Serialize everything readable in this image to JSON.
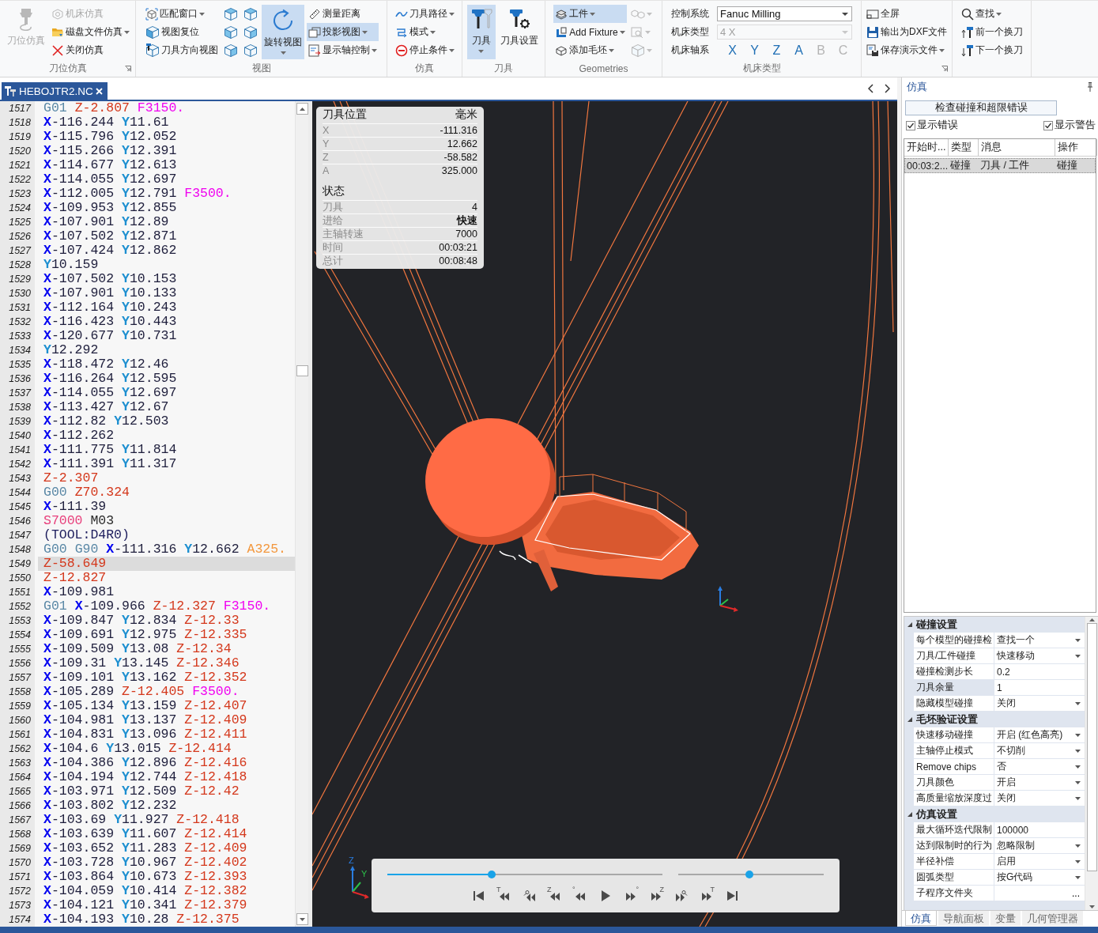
{
  "ribbon": {
    "groups": [
      {
        "label": "刀位仿真",
        "launcher": true,
        "items": [
          {
            "kind": "large",
            "label": "刀位仿真",
            "dropdown": false,
            "selected": false,
            "disabled": true
          },
          {
            "kind": "small",
            "label": "机床仿真",
            "dropdown": false,
            "selected": false,
            "disabled": true
          },
          {
            "kind": "small",
            "label": "磁盘文件仿真",
            "dropdown": true,
            "selected": false,
            "disabled": false
          },
          {
            "kind": "small",
            "label": "关闭仿真",
            "dropdown": false,
            "selected": false,
            "disabled": false
          }
        ]
      },
      {
        "label": "视图",
        "items": [
          {
            "kind": "small",
            "label": "匹配窗口",
            "dropdown": true,
            "selected": false,
            "disabled": false
          },
          {
            "kind": "small",
            "label": "视图复位",
            "dropdown": false,
            "selected": false,
            "disabled": false
          },
          {
            "kind": "small",
            "label": "刀具方向视图",
            "dropdown": false,
            "selected": false,
            "disabled": false
          },
          {
            "kind": "icon",
            "dropdown": false,
            "selected": false,
            "disabled": false
          },
          {
            "kind": "icon",
            "dropdown": false,
            "selected": false,
            "disabled": false
          },
          {
            "kind": "icon",
            "dropdown": false,
            "selected": false,
            "disabled": false
          },
          {
            "kind": "icon",
            "dropdown": false,
            "selected": false,
            "disabled": false
          },
          {
            "kind": "icon",
            "dropdown": false,
            "selected": false,
            "disabled": false
          },
          {
            "kind": "icon",
            "dropdown": false,
            "selected": false,
            "disabled": false
          },
          {
            "kind": "large",
            "label": "旋转视图",
            "dropdown": true,
            "selected": true,
            "disabled": false
          },
          {
            "kind": "small",
            "label": "测量距离",
            "dropdown": false,
            "selected": false,
            "disabled": false
          },
          {
            "kind": "small",
            "label": "投影视图",
            "dropdown": true,
            "selected": true,
            "disabled": false
          },
          {
            "kind": "small",
            "label": "显示轴控制",
            "dropdown": true,
            "selected": false,
            "disabled": false
          }
        ]
      },
      {
        "label": "仿真",
        "items": [
          {
            "kind": "small",
            "label": "刀具路径",
            "dropdown": true,
            "selected": false,
            "disabled": false
          },
          {
            "kind": "small",
            "label": "模式",
            "dropdown": true,
            "selected": false,
            "disabled": false
          },
          {
            "kind": "small",
            "label": "停止条件",
            "dropdown": true,
            "selected": false,
            "disabled": false
          }
        ]
      },
      {
        "label": "刀具",
        "items": [
          {
            "kind": "large",
            "label": "刀具",
            "dropdown": true,
            "selected": true,
            "disabled": false
          },
          {
            "kind": "large",
            "label": "刀具设置",
            "dropdown": false,
            "selected": false,
            "disabled": false
          }
        ]
      },
      {
        "label": "Geometries",
        "items": [
          {
            "kind": "small",
            "label": "工件",
            "dropdown": true,
            "selected": true,
            "disabled": false
          },
          {
            "kind": "small",
            "label": "Add Fixture",
            "dropdown": true,
            "selected": false,
            "disabled": false
          },
          {
            "kind": "small",
            "label": "添加毛坯",
            "dropdown": true,
            "selected": false,
            "disabled": false
          },
          {
            "kind": "icon",
            "dropdown": true,
            "selected": false,
            "disabled": true
          },
          {
            "kind": "icon",
            "dropdown": true,
            "selected": false,
            "disabled": true
          },
          {
            "kind": "icon",
            "dropdown": true,
            "selected": false,
            "disabled": true
          }
        ]
      },
      {
        "label": "机床类型",
        "items": [
          {
            "kind": "combo",
            "label": "控制系统",
            "value": "Fanuc Milling",
            "disabled": false
          },
          {
            "kind": "combo",
            "label": "机床类型",
            "value": "4 X",
            "disabled": true
          },
          {
            "kind": "axes",
            "label": "机床轴系",
            "axes": [
              {
                "text": "X",
                "disabled": false
              },
              {
                "text": "Y",
                "disabled": false
              },
              {
                "text": "Z",
                "disabled": false
              },
              {
                "text": "A",
                "disabled": false
              },
              {
                "text": "B",
                "disabled": true
              },
              {
                "text": "C",
                "disabled": true
              }
            ]
          }
        ]
      },
      {
        "launcher": true,
        "items": [
          {
            "kind": "small",
            "label": "全屏",
            "dropdown": false,
            "selected": false,
            "disabled": false
          },
          {
            "kind": "small",
            "label": "输出为DXF文件",
            "dropdown": false,
            "selected": false,
            "disabled": false
          },
          {
            "kind": "small",
            "label": "保存演示文件",
            "dropdown": true,
            "selected": false,
            "disabled": false
          }
        ]
      },
      {
        "items": [
          {
            "kind": "small",
            "label": "查找",
            "dropdown": true,
            "selected": false,
            "disabled": false
          },
          {
            "kind": "small",
            "label": "前一个换刀",
            "dropdown": false,
            "selected": false,
            "disabled": false
          },
          {
            "kind": "small",
            "label": "下一个换刀",
            "dropdown": false,
            "selected": false,
            "disabled": false
          }
        ]
      }
    ]
  },
  "editor": {
    "tab": {
      "title": "HEBOJTR2.NC"
    },
    "lines": [
      {
        "number": "1517",
        "selected": false,
        "tokens": [
          {
            "kind": "g",
            "text": "G01"
          },
          {
            "kind": "z",
            "text": "Z-2.807"
          },
          {
            "kind": "f",
            "text": "F3150."
          }
        ]
      },
      {
        "number": "1518",
        "selected": false,
        "tokens": [
          {
            "kind": "x",
            "text": "X-116.244"
          },
          {
            "kind": "y",
            "text": "Y11.61"
          }
        ]
      },
      {
        "number": "1519",
        "selected": false,
        "tokens": [
          {
            "kind": "x",
            "text": "X-115.796"
          },
          {
            "kind": "y",
            "text": "Y12.052"
          }
        ]
      },
      {
        "number": "1520",
        "selected": false,
        "tokens": [
          {
            "kind": "x",
            "text": "X-115.266"
          },
          {
            "kind": "y",
            "text": "Y12.391"
          }
        ]
      },
      {
        "number": "1521",
        "selected": false,
        "tokens": [
          {
            "kind": "x",
            "text": "X-114.677"
          },
          {
            "kind": "y",
            "text": "Y12.613"
          }
        ]
      },
      {
        "number": "1522",
        "selected": false,
        "tokens": [
          {
            "kind": "x",
            "text": "X-114.055"
          },
          {
            "kind": "y",
            "text": "Y12.697"
          }
        ]
      },
      {
        "number": "1523",
        "selected": false,
        "tokens": [
          {
            "kind": "x",
            "text": "X-112.005"
          },
          {
            "kind": "y",
            "text": "Y12.791"
          },
          {
            "kind": "f",
            "text": "F3500."
          }
        ]
      },
      {
        "number": "1524",
        "selected": false,
        "tokens": [
          {
            "kind": "x",
            "text": "X-109.953"
          },
          {
            "kind": "y",
            "text": "Y12.855"
          }
        ]
      },
      {
        "number": "1525",
        "selected": false,
        "tokens": [
          {
            "kind": "x",
            "text": "X-107.901"
          },
          {
            "kind": "y",
            "text": "Y12.89"
          }
        ]
      },
      {
        "number": "1526",
        "selected": false,
        "tokens": [
          {
            "kind": "x",
            "text": "X-107.502"
          },
          {
            "kind": "y",
            "text": "Y12.871"
          }
        ]
      },
      {
        "number": "1527",
        "selected": false,
        "tokens": [
          {
            "kind": "x",
            "text": "X-107.424"
          },
          {
            "kind": "y",
            "text": "Y12.862"
          }
        ]
      },
      {
        "number": "1528",
        "selected": false,
        "tokens": [
          {
            "kind": "y",
            "text": "Y10.159"
          }
        ]
      },
      {
        "number": "1529",
        "selected": false,
        "tokens": [
          {
            "kind": "x",
            "text": "X-107.502"
          },
          {
            "kind": "y",
            "text": "Y10.153"
          }
        ]
      },
      {
        "number": "1530",
        "selected": false,
        "tokens": [
          {
            "kind": "x",
            "text": "X-107.901"
          },
          {
            "kind": "y",
            "text": "Y10.133"
          }
        ]
      },
      {
        "number": "1531",
        "selected": false,
        "tokens": [
          {
            "kind": "x",
            "text": "X-112.164"
          },
          {
            "kind": "y",
            "text": "Y10.243"
          }
        ]
      },
      {
        "number": "1532",
        "selected": false,
        "tokens": [
          {
            "kind": "x",
            "text": "X-116.423"
          },
          {
            "kind": "y",
            "text": "Y10.443"
          }
        ]
      },
      {
        "number": "1533",
        "selected": false,
        "tokens": [
          {
            "kind": "x",
            "text": "X-120.677"
          },
          {
            "kind": "y",
            "text": "Y10.731"
          }
        ]
      },
      {
        "number": "1534",
        "selected": false,
        "tokens": [
          {
            "kind": "y",
            "text": "Y12.292"
          }
        ]
      },
      {
        "number": "1535",
        "selected": false,
        "tokens": [
          {
            "kind": "x",
            "text": "X-118.472"
          },
          {
            "kind": "y",
            "text": "Y12.46"
          }
        ]
      },
      {
        "number": "1536",
        "selected": false,
        "tokens": [
          {
            "kind": "x",
            "text": "X-116.264"
          },
          {
            "kind": "y",
            "text": "Y12.595"
          }
        ]
      },
      {
        "number": "1537",
        "selected": false,
        "tokens": [
          {
            "kind": "x",
            "text": "X-114.055"
          },
          {
            "kind": "y",
            "text": "Y12.697"
          }
        ]
      },
      {
        "number": "1538",
        "selected": false,
        "tokens": [
          {
            "kind": "x",
            "text": "X-113.427"
          },
          {
            "kind": "y",
            "text": "Y12.67"
          }
        ]
      },
      {
        "number": "1539",
        "selected": false,
        "tokens": [
          {
            "kind": "x",
            "text": "X-112.82"
          },
          {
            "kind": "y",
            "text": "Y12.503"
          }
        ]
      },
      {
        "number": "1540",
        "selected": false,
        "tokens": [
          {
            "kind": "x",
            "text": "X-112.262"
          }
        ]
      },
      {
        "number": "1541",
        "selected": false,
        "tokens": [
          {
            "kind": "x",
            "text": "X-111.775"
          },
          {
            "kind": "y",
            "text": "Y11.814"
          }
        ]
      },
      {
        "number": "1542",
        "selected": false,
        "tokens": [
          {
            "kind": "x",
            "text": "X-111.391"
          },
          {
            "kind": "y",
            "text": "Y11.317"
          }
        ]
      },
      {
        "number": "1543",
        "selected": false,
        "tokens": [
          {
            "kind": "z",
            "text": "Z-2.307"
          }
        ]
      },
      {
        "number": "1544",
        "selected": false,
        "tokens": [
          {
            "kind": "g",
            "text": "G00"
          },
          {
            "kind": "z",
            "text": "Z70.324"
          }
        ]
      },
      {
        "number": "1545",
        "selected": false,
        "tokens": [
          {
            "kind": "x",
            "text": "X-111.39"
          }
        ]
      },
      {
        "number": "1546",
        "selected": false,
        "tokens": [
          {
            "kind": "s",
            "text": "S7000"
          },
          {
            "kind": "m",
            "text": "M03"
          }
        ]
      },
      {
        "number": "1547",
        "selected": false,
        "tokens": [
          {
            "kind": "comment",
            "text": "(TOOL:D4R0)"
          }
        ]
      },
      {
        "number": "1548",
        "selected": false,
        "tokens": [
          {
            "kind": "g",
            "text": "G00"
          },
          {
            "kind": "g",
            "text": "G90"
          },
          {
            "kind": "x",
            "text": "X-111.316"
          },
          {
            "kind": "y",
            "text": "Y12.662"
          },
          {
            "kind": "a",
            "text": "A325."
          }
        ]
      },
      {
        "number": "1549",
        "selected": true,
        "tokens": [
          {
            "kind": "z",
            "text": "Z-58.649"
          }
        ]
      },
      {
        "number": "1550",
        "selected": false,
        "tokens": [
          {
            "kind": "z",
            "text": "Z-12.827"
          }
        ]
      },
      {
        "number": "1551",
        "selected": false,
        "tokens": [
          {
            "kind": "x",
            "text": "X-109.981"
          }
        ]
      },
      {
        "number": "1552",
        "selected": false,
        "tokens": [
          {
            "kind": "g",
            "text": "G01"
          },
          {
            "kind": "x",
            "text": "X-109.966"
          },
          {
            "kind": "z",
            "text": "Z-12.327"
          },
          {
            "kind": "f",
            "text": "F3150."
          }
        ]
      },
      {
        "number": "1553",
        "selected": false,
        "tokens": [
          {
            "kind": "x",
            "text": "X-109.847"
          },
          {
            "kind": "y",
            "text": "Y12.834"
          },
          {
            "kind": "z",
            "text": "Z-12.33"
          }
        ]
      },
      {
        "number": "1554",
        "selected": false,
        "tokens": [
          {
            "kind": "x",
            "text": "X-109.691"
          },
          {
            "kind": "y",
            "text": "Y12.975"
          },
          {
            "kind": "z",
            "text": "Z-12.335"
          }
        ]
      },
      {
        "number": "1555",
        "selected": false,
        "tokens": [
          {
            "kind": "x",
            "text": "X-109.509"
          },
          {
            "kind": "y",
            "text": "Y13.08"
          },
          {
            "kind": "z",
            "text": "Z-12.34"
          }
        ]
      },
      {
        "number": "1556",
        "selected": false,
        "tokens": [
          {
            "kind": "x",
            "text": "X-109.31"
          },
          {
            "kind": "y",
            "text": "Y13.145"
          },
          {
            "kind": "z",
            "text": "Z-12.346"
          }
        ]
      },
      {
        "number": "1557",
        "selected": false,
        "tokens": [
          {
            "kind": "x",
            "text": "X-109.101"
          },
          {
            "kind": "y",
            "text": "Y13.162"
          },
          {
            "kind": "z",
            "text": "Z-12.352"
          }
        ]
      },
      {
        "number": "1558",
        "selected": false,
        "tokens": [
          {
            "kind": "x",
            "text": "X-105.289"
          },
          {
            "kind": "z",
            "text": "Z-12.405"
          },
          {
            "kind": "f",
            "text": "F3500."
          }
        ]
      },
      {
        "number": "1559",
        "selected": false,
        "tokens": [
          {
            "kind": "x",
            "text": "X-105.134"
          },
          {
            "kind": "y",
            "text": "Y13.159"
          },
          {
            "kind": "z",
            "text": "Z-12.407"
          }
        ]
      },
      {
        "number": "1560",
        "selected": false,
        "tokens": [
          {
            "kind": "x",
            "text": "X-104.981"
          },
          {
            "kind": "y",
            "text": "Y13.137"
          },
          {
            "kind": "z",
            "text": "Z-12.409"
          }
        ]
      },
      {
        "number": "1561",
        "selected": false,
        "tokens": [
          {
            "kind": "x",
            "text": "X-104.831"
          },
          {
            "kind": "y",
            "text": "Y13.096"
          },
          {
            "kind": "z",
            "text": "Z-12.411"
          }
        ]
      },
      {
        "number": "1562",
        "selected": false,
        "tokens": [
          {
            "kind": "x",
            "text": "X-104.6"
          },
          {
            "kind": "y",
            "text": "Y13.015"
          },
          {
            "kind": "z",
            "text": "Z-12.414"
          }
        ]
      },
      {
        "number": "1563",
        "selected": false,
        "tokens": [
          {
            "kind": "x",
            "text": "X-104.386"
          },
          {
            "kind": "y",
            "text": "Y12.896"
          },
          {
            "kind": "z",
            "text": "Z-12.416"
          }
        ]
      },
      {
        "number": "1564",
        "selected": false,
        "tokens": [
          {
            "kind": "x",
            "text": "X-104.194"
          },
          {
            "kind": "y",
            "text": "Y12.744"
          },
          {
            "kind": "z",
            "text": "Z-12.418"
          }
        ]
      },
      {
        "number": "1565",
        "selected": false,
        "tokens": [
          {
            "kind": "x",
            "text": "X-103.971"
          },
          {
            "kind": "y",
            "text": "Y12.509"
          },
          {
            "kind": "z",
            "text": "Z-12.42"
          }
        ]
      },
      {
        "number": "1566",
        "selected": false,
        "tokens": [
          {
            "kind": "x",
            "text": "X-103.802"
          },
          {
            "kind": "y",
            "text": "Y12.232"
          }
        ]
      },
      {
        "number": "1567",
        "selected": false,
        "tokens": [
          {
            "kind": "x",
            "text": "X-103.69"
          },
          {
            "kind": "y",
            "text": "Y11.927"
          },
          {
            "kind": "z",
            "text": "Z-12.418"
          }
        ]
      },
      {
        "number": "1568",
        "selected": false,
        "tokens": [
          {
            "kind": "x",
            "text": "X-103.639"
          },
          {
            "kind": "y",
            "text": "Y11.607"
          },
          {
            "kind": "z",
            "text": "Z-12.414"
          }
        ]
      },
      {
        "number": "1569",
        "selected": false,
        "tokens": [
          {
            "kind": "x",
            "text": "X-103.652"
          },
          {
            "kind": "y",
            "text": "Y11.283"
          },
          {
            "kind": "z",
            "text": "Z-12.409"
          }
        ]
      },
      {
        "number": "1570",
        "selected": false,
        "tokens": [
          {
            "kind": "x",
            "text": "X-103.728"
          },
          {
            "kind": "y",
            "text": "Y10.967"
          },
          {
            "kind": "z",
            "text": "Z-12.402"
          }
        ]
      },
      {
        "number": "1571",
        "selected": false,
        "tokens": [
          {
            "kind": "x",
            "text": "X-103.864"
          },
          {
            "kind": "y",
            "text": "Y10.673"
          },
          {
            "kind": "z",
            "text": "Z-12.393"
          }
        ]
      },
      {
        "number": "1572",
        "selected": false,
        "tokens": [
          {
            "kind": "x",
            "text": "X-104.059"
          },
          {
            "kind": "y",
            "text": "Y10.414"
          },
          {
            "kind": "z",
            "text": "Z-12.382"
          }
        ]
      },
      {
        "number": "1573",
        "selected": false,
        "tokens": [
          {
            "kind": "x",
            "text": "X-104.121"
          },
          {
            "kind": "y",
            "text": "Y10.341"
          },
          {
            "kind": "z",
            "text": "Z-12.379"
          }
        ]
      },
      {
        "number": "1574",
        "selected": false,
        "tokens": [
          {
            "kind": "x",
            "text": "X-104.193"
          },
          {
            "kind": "y",
            "text": "Y10.28"
          },
          {
            "kind": "z",
            "text": "Z-12.375"
          }
        ]
      }
    ]
  },
  "viewport": {
    "position": {
      "title": "刀具位置",
      "unit": "毫米",
      "rows": [
        {
          "label": "X",
          "value": "-111.316",
          "highlighted": false
        },
        {
          "label": "Y",
          "value": "12.662",
          "highlighted": false
        },
        {
          "label": "Z",
          "value": "-58.582",
          "highlighted": false
        },
        {
          "label": "A",
          "value": "325.000",
          "highlighted": false
        }
      ]
    },
    "status": {
      "title": "状态",
      "rows": [
        {
          "label": "刀具",
          "value": "4",
          "highlighted": false
        },
        {
          "label": "进给",
          "value": "快速",
          "highlighted": true
        },
        {
          "label": "主轴转速",
          "value": "7000",
          "highlighted": false
        },
        {
          "label": "时间",
          "value": "00:03:21",
          "highlighted": false
        },
        {
          "label": "总计",
          "value": "00:08:48",
          "highlighted": false
        }
      ]
    },
    "triad_labels": [
      "Z",
      "Y"
    ],
    "playback": {
      "sliders": [
        {
          "kind": "progress",
          "level": 0.38
        },
        {
          "kind": "speed",
          "level": 0.49
        }
      ],
      "buttons": [
        {
          "kind": "start"
        },
        {
          "kind": "back",
          "mark": "T"
        },
        {
          "kind": "back-tool"
        },
        {
          "kind": "back",
          "mark": "Z"
        },
        {
          "kind": "back",
          "mark": "°"
        },
        {
          "kind": "play"
        },
        {
          "kind": "forward",
          "mark": "°"
        },
        {
          "kind": "forward",
          "mark": "Z"
        },
        {
          "kind": "forward-tool"
        },
        {
          "kind": "forward",
          "mark": "T"
        },
        {
          "kind": "end"
        }
      ]
    }
  },
  "simulation_panel": {
    "title": "仿真",
    "check_button": "检查碰撞和超限错误",
    "options": [
      {
        "label": "显示错误",
        "checked": true
      },
      {
        "label": "显示警告",
        "checked": true
      }
    ],
    "table": {
      "columns": [
        "开始时...",
        "类型",
        "消息",
        "操作"
      ],
      "rows": [
        {
          "cells": [
            "00:03:2...",
            "碰撞",
            "刀具 / 工件",
            "碰撞"
          ],
          "selected": true
        }
      ]
    },
    "properties": [
      {
        "name": "碰撞设置",
        "expanded": true,
        "rows": [
          {
            "name": "每个模型的碰撞检",
            "value": "查找一个",
            "kind": "choice",
            "selected": false
          },
          {
            "name": "刀具/工件碰撞",
            "value": "快速移动",
            "kind": "choice",
            "selected": false
          },
          {
            "name": "碰撞检测步长",
            "value": "0.2",
            "kind": "text",
            "selected": false
          },
          {
            "name": "刀具余量",
            "value": "1",
            "kind": "text",
            "selected": true
          },
          {
            "name": "隐藏模型碰撞",
            "value": "关闭",
            "kind": "choice",
            "selected": false
          }
        ]
      },
      {
        "name": "毛坯验证设置",
        "expanded": true,
        "rows": [
          {
            "name": "快速移动碰撞",
            "value": "开启 (红色高亮)",
            "kind": "choice",
            "selected": false
          },
          {
            "name": "主轴停止模式",
            "value": "不切削",
            "kind": "choice",
            "selected": false
          },
          {
            "name": "Remove chips",
            "value": "否",
            "kind": "choice",
            "selected": false
          },
          {
            "name": "刀具颜色",
            "value": "开启",
            "kind": "choice",
            "selected": false
          },
          {
            "name": "高质量缩放深度过",
            "value": "关闭",
            "kind": "choice",
            "selected": false
          }
        ]
      },
      {
        "name": "仿真设置",
        "expanded": true,
        "rows": [
          {
            "name": "最大循环迭代限制",
            "value": "100000",
            "kind": "text",
            "selected": false
          },
          {
            "name": "达到限制时的行为",
            "value": "忽略限制",
            "kind": "choice",
            "selected": false
          },
          {
            "name": "半径补偿",
            "value": "启用",
            "kind": "choice",
            "selected": false
          },
          {
            "name": "圆弧类型",
            "value": "按G代码",
            "kind": "choice",
            "selected": false
          },
          {
            "name": "子程序文件夹",
            "kind": "browse",
            "button": "...",
            "selected": false
          }
        ]
      }
    ],
    "tabs": [
      {
        "label": "仿真",
        "selected": true
      },
      {
        "label": "导航面板",
        "selected": false
      },
      {
        "label": "变量",
        "selected": false
      },
      {
        "label": "几何管理器",
        "selected": false
      }
    ]
  }
}
